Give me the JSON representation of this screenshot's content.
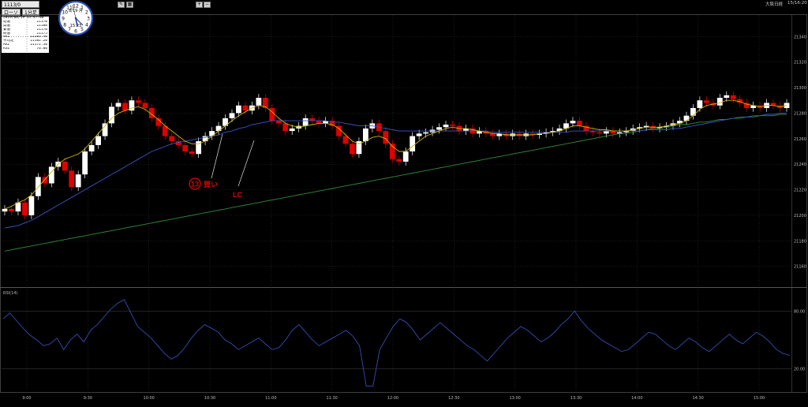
{
  "toolbar": {
    "symbol": "1113/0",
    "period": "1分足",
    "chart_type": "ローソク",
    "corner_label": "大阪日経",
    "corner_time": "15/16:20"
  },
  "info_panel": {
    "datetime": "2019/08/19 15:47:00",
    "rows": [
      {
        "label": "始値",
        "value": "21170"
      },
      {
        "label": "高値",
        "value": "21180"
      },
      {
        "label": "安値",
        "value": "21170"
      },
      {
        "label": "終値",
        "value": "21175"
      },
      {
        "label": "MA1",
        "value": "21183.40"
      },
      {
        "label": "平均足",
        "value": "21182.20"
      },
      {
        "label": "MA2",
        "value": "21172.50"
      },
      {
        "label": "RSI",
        "value": "76.00"
      }
    ]
  },
  "clock": {
    "numbers": [
      "12",
      "1",
      "2",
      "3",
      "4",
      "5",
      "6",
      "7",
      "8",
      "9",
      "10",
      "11"
    ],
    "date_label": "8/19",
    "weekday": "月",
    "time": "15:23"
  },
  "annotations": {
    "buy_number": "⑬",
    "buy_label": "買い",
    "lc_label": "LC"
  },
  "colors": {
    "up": "#ffffff",
    "down": "#e00000",
    "ma_short": "#c8b400",
    "ma_mid": "#3a55c8",
    "ma_long": "#2e8b3a",
    "rsi": "#3a55c8",
    "annotation": "#e00000"
  },
  "chart_data": [
    {
      "type": "candlestick",
      "title": "",
      "x_ticks": [
        "9:00",
        "9:30",
        "10:00",
        "10:30",
        "11:00",
        "11:30",
        "12:00",
        "12:30",
        "13:00",
        "13:30",
        "14:00",
        "14:30",
        "15:00"
      ],
      "y_ticks": [
        21340,
        21320,
        21300,
        21280,
        21260,
        21240,
        21220,
        21200,
        21180,
        21160
      ],
      "ylim": [
        21145,
        21355
      ],
      "grid": true,
      "close_series": [
        21205,
        21203,
        21210,
        21200,
        21215,
        21230,
        21225,
        21238,
        21242,
        21235,
        21222,
        21232,
        21250,
        21255,
        21262,
        21272,
        21285,
        21288,
        21282,
        21290,
        21288,
        21284,
        21276,
        21270,
        21262,
        21258,
        21255,
        21250,
        21248,
        21258,
        21262,
        21266,
        21270,
        21276,
        21280,
        21286,
        21282,
        21286,
        21292,
        21284,
        21274,
        21272,
        21266,
        21268,
        21270,
        21276,
        21274,
        21272,
        21274,
        21270,
        21262,
        21256,
        21248,
        21258,
        21268,
        21272,
        21266,
        21256,
        21244,
        21242,
        21250,
        21262,
        21264,
        21265,
        21267,
        21269,
        21271,
        21270,
        21266,
        21268,
        21264,
        21266,
        21264,
        21262,
        21264,
        21262,
        21264,
        21262,
        21264,
        21263,
        21264,
        21265,
        21266,
        21268,
        21272,
        21274,
        21270,
        21266,
        21265,
        21264,
        21266,
        21264,
        21265,
        21266,
        21268,
        21269,
        21270,
        21268,
        21269,
        21270,
        21272,
        21274,
        21278,
        21284,
        21290,
        21288,
        21286,
        21292,
        21294,
        21291,
        21288,
        21284,
        21286,
        21284,
        21288,
        21286,
        21284,
        21288
      ],
      "ma_short": [
        21205,
        21207,
        21210,
        21212,
        21216,
        21222,
        21228,
        21234,
        21240,
        21244,
        21246,
        21248,
        21252,
        21258,
        21264,
        21270,
        21276,
        21280,
        21282,
        21284,
        21285,
        21283,
        21279,
        21275,
        21270,
        21266,
        21262,
        21258,
        21256,
        21256,
        21258,
        21262,
        21266,
        21270,
        21274,
        21278,
        21281,
        21284,
        21286,
        21285,
        21281,
        21276,
        21272,
        21270,
        21269,
        21270,
        21271,
        21272,
        21272,
        21271,
        21268,
        21263,
        21258,
        21256,
        21258,
        21261,
        21262,
        21260,
        21254,
        21250,
        21250,
        21254,
        21258,
        21262,
        21264,
        21266,
        21268,
        21269,
        21268,
        21268,
        21267,
        21266,
        21265,
        21264,
        21264,
        21263,
        21263,
        21263,
        21263,
        21263,
        21264,
        21264,
        21265,
        21266,
        21268,
        21270,
        21270,
        21269,
        21268,
        21267,
        21267,
        21266,
        21266,
        21266,
        21267,
        21268,
        21269,
        21269,
        21269,
        21270,
        21271,
        21272,
        21274,
        21278,
        21283,
        21286,
        21287,
        21288,
        21290,
        21290,
        21289,
        21287,
        21286,
        21285,
        21286,
        21286,
        21285,
        21286
      ],
      "ma_mid": [
        21190,
        21191,
        21192,
        21194,
        21196,
        21199,
        21202,
        21205,
        21208,
        21211,
        21214,
        21217,
        21220,
        21223,
        21226,
        21229,
        21232,
        21235,
        21238,
        21241,
        21244,
        21247,
        21250,
        21252,
        21254,
        21256,
        21257,
        21258,
        21259,
        21260,
        21261,
        21262,
        21263,
        21265,
        21266,
        21268,
        21269,
        21271,
        21272,
        21273,
        21274,
        21274,
        21274,
        21274,
        21274,
        21274,
        21274,
        21274,
        21274,
        21273,
        21273,
        21272,
        21271,
        21270,
        21270,
        21270,
        21269,
        21268,
        21267,
        21266,
        21266,
        21266,
        21266,
        21266,
        21266,
        21266,
        21266,
        21266,
        21266,
        21266,
        21266,
        21266,
        21266,
        21265,
        21265,
        21265,
        21265,
        21265,
        21265,
        21265,
        21265,
        21265,
        21265,
        21265,
        21265,
        21266,
        21266,
        21266,
        21266,
        21266,
        21266,
        21266,
        21266,
        21266,
        21266,
        21266,
        21267,
        21267,
        21267,
        21267,
        21268,
        21268,
        21269,
        21270,
        21271,
        21272,
        21273,
        21274,
        21275,
        21276,
        21277,
        21277,
        21278,
        21278,
        21279,
        21279,
        21280,
        21280
      ],
      "ma_long": [
        21172,
        21173,
        21174,
        21175,
        21176,
        21177,
        21178,
        21179,
        21180,
        21181,
        21182,
        21183,
        21184,
        21185,
        21186,
        21187,
        21188,
        21189,
        21190,
        21191,
        21192,
        21193,
        21194,
        21195,
        21196,
        21197,
        21198,
        21199,
        21200,
        21201,
        21202,
        21203,
        21204,
        21205,
        21206,
        21207,
        21208,
        21209,
        21210,
        21211,
        21212,
        21213,
        21214,
        21215,
        21216,
        21217,
        21218,
        21219,
        21220,
        21221,
        21222,
        21223,
        21224,
        21225,
        21226,
        21227,
        21228,
        21229,
        21230,
        21231,
        21232,
        21233,
        21234,
        21235,
        21236,
        21237,
        21238,
        21239,
        21240,
        21241,
        21242,
        21243,
        21244,
        21245,
        21246,
        21247,
        21248,
        21249,
        21250,
        21251,
        21252,
        21253,
        21254,
        21255,
        21256,
        21257,
        21258,
        21259,
        21260,
        21261,
        21262,
        21263,
        21264,
        21264,
        21265,
        21266,
        21267,
        21268,
        21268,
        21269,
        21270,
        21271,
        21271,
        21272,
        21273,
        21273,
        21274,
        21275,
        21275,
        21276,
        21276,
        21277,
        21277,
        21278,
        21278,
        21278,
        21279,
        21279
      ]
    },
    {
      "type": "line",
      "title": "RSI(14)",
      "y_ticks": [
        80,
        20
      ],
      "ylim": [
        0,
        100
      ],
      "grid": true,
      "values": [
        72,
        78,
        70,
        62,
        55,
        50,
        44,
        46,
        52,
        40,
        50,
        56,
        48,
        60,
        66,
        74,
        82,
        88,
        92,
        78,
        64,
        58,
        52,
        44,
        36,
        30,
        34,
        42,
        52,
        60,
        66,
        62,
        58,
        50,
        46,
        40,
        44,
        48,
        52,
        46,
        40,
        42,
        50,
        60,
        66,
        58,
        50,
        44,
        48,
        52,
        56,
        60,
        54,
        44,
        2,
        2,
        40,
        52,
        64,
        72,
        68,
        60,
        50,
        56,
        62,
        68,
        62,
        56,
        50,
        44,
        40,
        34,
        28,
        36,
        44,
        52,
        58,
        64,
        60,
        54,
        48,
        52,
        58,
        66,
        72,
        80,
        70,
        62,
        56,
        50,
        46,
        42,
        38,
        40,
        46,
        52,
        58,
        56,
        50,
        44,
        40,
        46,
        52,
        48,
        42,
        38,
        44,
        50,
        56,
        50,
        46,
        52,
        58,
        54,
        48,
        40,
        36,
        34
      ]
    }
  ]
}
